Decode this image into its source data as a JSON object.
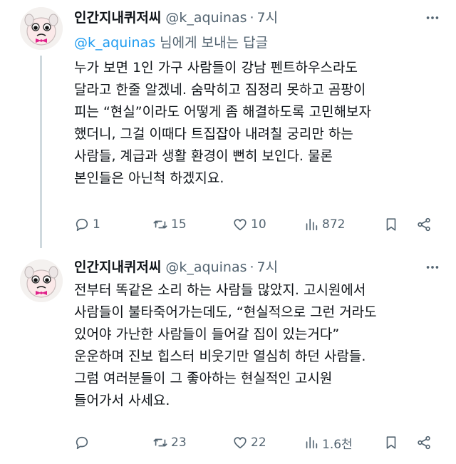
{
  "tweets": [
    {
      "display_name": "인간지내퀴저씨",
      "handle": "@k_aquinas",
      "time": "7시",
      "reply_to": {
        "handle": "@k_aquinas",
        "suffix": "님에게 보내는 답글"
      },
      "lines": [
        "누가 보면 1인 가구 사람들이 강남 펜트하우스라도",
        "달라고 한줄 알겠네. 숨막히고 짐정리 못하고 곰팡이",
        "피는 “현실”이라도 어떻게 좀 해결하도록 고민해보자",
        "했더니, 그걸 이때다 트집잡아 내려칠 궁리만 하는",
        "사람들, 계급과 생활 환경이 뻔히 보인다. 물론",
        "본인들은 아닌척 하겠지요."
      ],
      "stats": {
        "replies": "1",
        "retweets": "15",
        "likes": "10",
        "views": "872"
      }
    },
    {
      "display_name": "인간지내퀴저씨",
      "handle": "@k_aquinas",
      "time": "7시",
      "lines": [
        "전부터 똑같은 소리 하는 사람들 많았지. 고시원에서",
        "사람들이 불타죽어가는데도, “현실적으로 그런 거라도",
        "있어야 가난한 사람들이 들어갈 집이 있는거다”",
        "운운하며 진보 힙스터 비웃기만 열심히 하던 사람들.",
        "그럼 여러분들이 그 좋아하는 현실적인 고시원",
        "들어가서 사세요."
      ],
      "stats": {
        "replies": "",
        "retweets": "23",
        "likes": "22",
        "views": "1.6천"
      }
    }
  ],
  "icons": {
    "reply": "speech-bubble-icon",
    "retweet": "retweet-icon",
    "like": "heart-icon",
    "views": "bar-chart-icon",
    "bookmark": "bookmark-icon",
    "share": "share-icon",
    "more": "more-dots-icon"
  },
  "colors": {
    "text": "#0f1419",
    "secondary": "#536471",
    "link": "#1d9bf0",
    "thread_line": "#cfd9de",
    "avatar_bow": "#e0218a"
  }
}
